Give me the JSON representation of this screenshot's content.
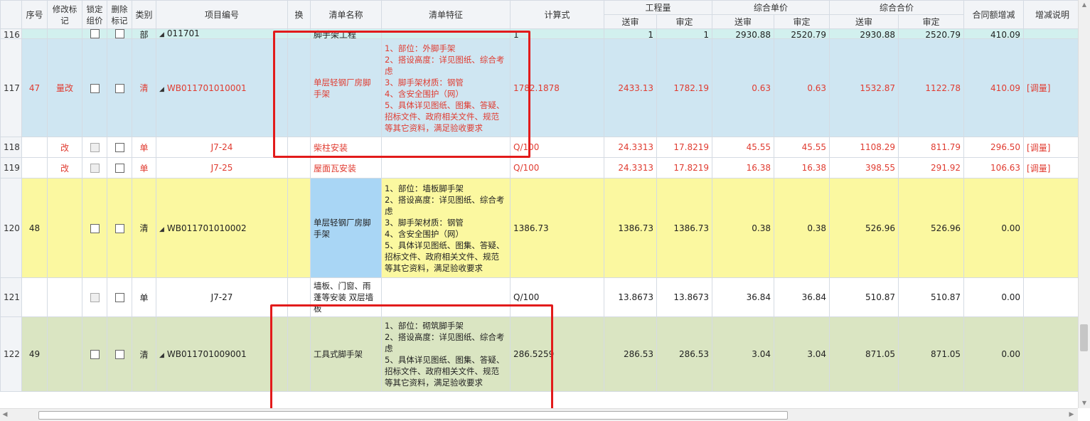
{
  "headers": {
    "seq": "序号",
    "modify_mark": "修改标记",
    "lock_price": "锁定组价",
    "delete_mark": "删除标记",
    "category": "类别",
    "item_code": "项目编号",
    "swap": "换",
    "item_name": "清单名称",
    "item_feature": "清单特征",
    "formula": "计算式",
    "qty_group": "工程量",
    "unit_price_group": "综合单价",
    "total_price_group": "综合合价",
    "sub_submitted": "送审",
    "sub_approved": "审定",
    "contract_change": "合同额增减",
    "change_note": "增减说明"
  },
  "rows": [
    {
      "row": "116",
      "seq": "",
      "mark": "",
      "category": "部",
      "code": "011701",
      "name": "脚手架工程",
      "feature": "",
      "formula": "1",
      "qty_sub": "1",
      "qty_app": "1",
      "up_sub": "2930.88",
      "up_app": "2520.79",
      "tp_sub": "2930.88",
      "tp_app": "2520.79",
      "change": "410.09",
      "note": ""
    },
    {
      "row": "117",
      "seq": "47",
      "mark": "量改",
      "category": "清",
      "code": "WB011701010001",
      "name": "单层轻钢厂房脚手架",
      "feature": "1、部位：外脚手架\n2、搭设高度：详见图纸、综合考虑\n3、脚手架材质：钢管\n4、含安全围护（网）\n5、具体详见图纸、图集、答疑、招标文件、政府相关文件、规范等其它资料，满足验收要求",
      "formula": "1782.1878",
      "qty_sub": "2433.13",
      "qty_app": "1782.19",
      "up_sub": "0.63",
      "up_app": "0.63",
      "tp_sub": "1532.87",
      "tp_app": "1122.78",
      "change": "410.09",
      "note": "[调量]"
    },
    {
      "row": "118",
      "seq": "",
      "mark": "改",
      "category": "单",
      "code": "J7-24",
      "name": "柴柱安装",
      "feature": "",
      "formula": "Q/100",
      "qty_sub": "24.3313",
      "qty_app": "17.8219",
      "up_sub": "45.55",
      "up_app": "45.55",
      "tp_sub": "1108.29",
      "tp_app": "811.79",
      "change": "296.50",
      "note": "[调量]"
    },
    {
      "row": "119",
      "seq": "",
      "mark": "改",
      "category": "单",
      "code": "J7-25",
      "name": "屋面瓦安装",
      "feature": "",
      "formula": "Q/100",
      "qty_sub": "24.3313",
      "qty_app": "17.8219",
      "up_sub": "16.38",
      "up_app": "16.38",
      "tp_sub": "398.55",
      "tp_app": "291.92",
      "change": "106.63",
      "note": "[调量]"
    },
    {
      "row": "120",
      "seq": "48",
      "mark": "",
      "category": "清",
      "code": "WB011701010002",
      "name": "单层轻钢厂房脚手架",
      "feature": "1、部位：墙板脚手架\n2、搭设高度：详见图纸、综合考虑\n3、脚手架材质：钢管\n4、含安全围护（网）\n5、具体详见图纸、图集、答疑、招标文件、政府相关文件、规范等其它资料，满足验收要求",
      "formula": "1386.73",
      "qty_sub": "1386.73",
      "qty_app": "1386.73",
      "up_sub": "0.38",
      "up_app": "0.38",
      "tp_sub": "526.96",
      "tp_app": "526.96",
      "change": "0.00",
      "note": ""
    },
    {
      "row": "121",
      "seq": "",
      "mark": "",
      "category": "单",
      "code": "J7-27",
      "name": "墙板、门窗、雨蓬等安装 双层墙板",
      "feature": "",
      "formula": "Q/100",
      "qty_sub": "13.8673",
      "qty_app": "13.8673",
      "up_sub": "36.84",
      "up_app": "36.84",
      "tp_sub": "510.87",
      "tp_app": "510.87",
      "change": "0.00",
      "note": ""
    },
    {
      "row": "122",
      "seq": "49",
      "mark": "",
      "category": "清",
      "code": "WB011701009001",
      "name": "工具式脚手架",
      "feature": "1、部位：砌筑脚手架\n2、搭设高度：详见图纸、综合考虑\n5、具体详见图纸、图集、答疑、招标文件、政府相关文件、规范等其它资料，满足验收要求",
      "formula": "286.5259",
      "qty_sub": "286.53",
      "qty_app": "286.53",
      "up_sub": "3.04",
      "up_app": "3.04",
      "tp_sub": "871.05",
      "tp_app": "871.05",
      "change": "0.00",
      "note": ""
    }
  ],
  "colors": {
    "highlight": "#e21b1b",
    "red_text": "#e03c31",
    "row_blue": "#cfe6f2",
    "row_yellow": "#fbf8a0",
    "row_green": "#dae5c2",
    "row_teal": "#d2f0ee"
  }
}
